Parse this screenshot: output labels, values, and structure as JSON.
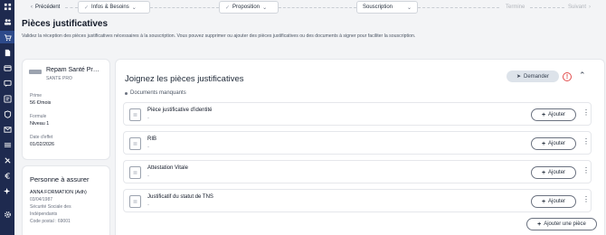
{
  "sidebar": {
    "icons": [
      "grid-icon",
      "people-icon",
      "cart-icon",
      "document-icon",
      "folder-icon",
      "chat-icon",
      "dashboard-icon",
      "shield-icon",
      "mail-icon",
      "list-icon",
      "tools-icon",
      "euro-icon",
      "sparkle-icon",
      "gear-icon"
    ],
    "active_index": 2,
    "colors": {
      "background": "#1e2a4f",
      "active": "#2d4a8a"
    }
  },
  "nav": {
    "previous": "Précédent",
    "steps": [
      {
        "label": "Infos & Besoins",
        "state": "done"
      },
      {
        "label": "Proposition",
        "state": "done"
      },
      {
        "label": "Souscription",
        "state": "current"
      },
      {
        "label": "Termine",
        "state": "disabled"
      }
    ],
    "next": "Suivant"
  },
  "page": {
    "title": "Pièces justificatives",
    "subtitle": "Validez la réception des pièces justificatives nécessaires à la souscription. Vous pouvez supprimer ou ajouter des pièces justificatives ou des documents à signer pour faciliter la souscription."
  },
  "product": {
    "name": "Repam Santé Pr…",
    "category": "SANTE PRO",
    "prime_label": "Prime",
    "prime_value": "56 €/mois",
    "formule_label": "Formule",
    "formule_value": "Niveau 1",
    "date_label": "Date d'effet",
    "date_value": "01/02/2026"
  },
  "insured": {
    "title": "Personne à assurer",
    "name": "ANNA FORMATION (Adh)",
    "birthdate": "03/04/1987",
    "regime_line1": "Sécurité Sociale des",
    "regime_line2": "Indépendants",
    "postal": "Code postal : 69001"
  },
  "documents": {
    "title": "Joignez les pièces justificatives",
    "request_button": "Demander",
    "warning_symbol": "!",
    "section": "Documents manquants",
    "add_label": "Ajouter",
    "items": [
      {
        "name": "Pièce justificative d'identité",
        "detail": "-"
      },
      {
        "name": "RIB",
        "detail": "-"
      },
      {
        "name": "Attestation Vitale",
        "detail": "-"
      },
      {
        "name": "Justificatif du statut de TNS",
        "detail": "-"
      }
    ],
    "add_piece_button": "Ajouter une pièce"
  }
}
